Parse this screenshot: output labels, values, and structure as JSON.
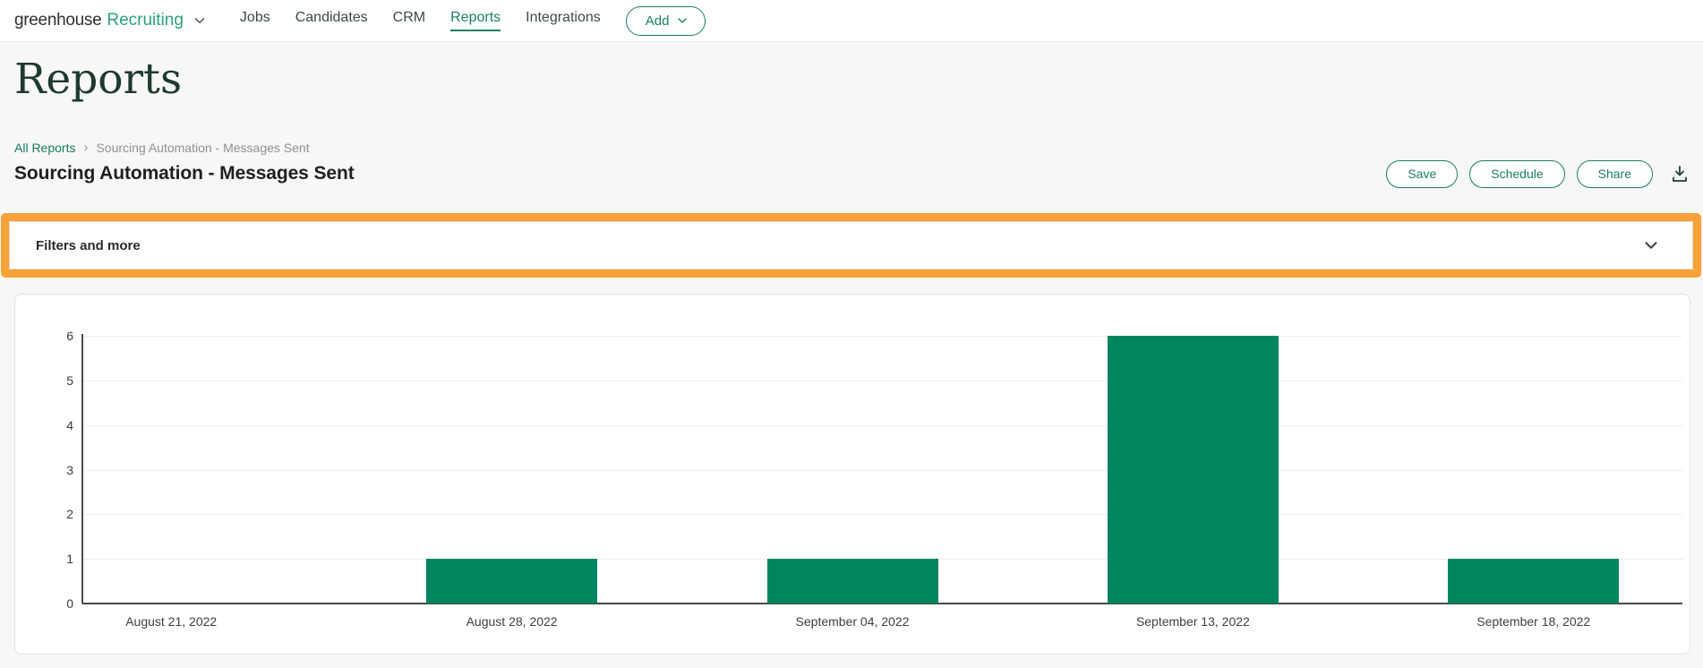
{
  "nav": {
    "logo": {
      "brand": "greenhouse",
      "product": "Recruiting"
    },
    "items": [
      {
        "label": "Jobs",
        "active": false
      },
      {
        "label": "Candidates",
        "active": false
      },
      {
        "label": "CRM",
        "active": false
      },
      {
        "label": "Reports",
        "active": true
      },
      {
        "label": "Integrations",
        "active": false
      }
    ],
    "add_button": {
      "label": "Add"
    }
  },
  "page": {
    "title": "Reports"
  },
  "breadcrumb": {
    "link": "All Reports",
    "separator": "›",
    "current": "Sourcing Automation - Messages Sent"
  },
  "report": {
    "title": "Sourcing Automation - Messages Sent",
    "actions": {
      "save": "Save",
      "schedule": "Schedule",
      "share": "Share"
    }
  },
  "filters": {
    "label": "Filters and more"
  },
  "icons": {
    "logo_dropdown": "chevron-down",
    "add_dropdown": "chevron-down",
    "breadcrumb_separator": "chevron-right",
    "download": "download-tray-arrow",
    "filters_toggle": "chevron-down"
  },
  "colors": {
    "brand_green": "#1a815c",
    "logo_green": "#2aa17c",
    "bar_green": "#00855e",
    "highlight_orange": "#f7a239",
    "heading_green": "#1e3a2e"
  },
  "chart_data": {
    "type": "bar",
    "title": "",
    "xlabel": "",
    "ylabel": "",
    "categories": [
      "August 21, 2022",
      "August 28, 2022",
      "September 04, 2022",
      "September 13, 2022",
      "September 18, 2022"
    ],
    "values": [
      0,
      1,
      1,
      6,
      1
    ],
    "yticks": [
      0,
      1,
      2,
      3,
      4,
      5,
      6
    ],
    "ylim": [
      0,
      6
    ],
    "grid": true,
    "legend": false,
    "bar_color": "#00855e"
  }
}
